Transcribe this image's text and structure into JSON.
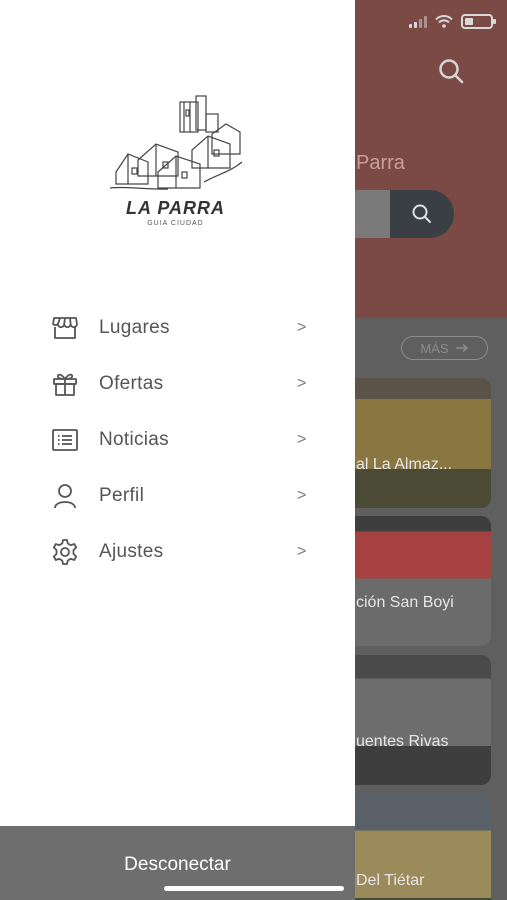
{
  "background": {
    "hero_title": "Parra",
    "more_label": "MÁS",
    "cards": [
      {
        "label": "al La Almaz..."
      },
      {
        "label": "ción San Boyi"
      },
      {
        "label": "uentes Rivas"
      },
      {
        "label": "Del Tiétar"
      }
    ]
  },
  "drawer": {
    "logo": {
      "title": "LA PARRA",
      "subtitle": "GUIA CIUDAD"
    },
    "menu": [
      {
        "label": "Lugares",
        "icon": "store-icon"
      },
      {
        "label": "Ofertas",
        "icon": "gift-icon"
      },
      {
        "label": "Noticias",
        "icon": "news-icon"
      },
      {
        "label": "Perfil",
        "icon": "user-icon"
      },
      {
        "label": "Ajustes",
        "icon": "gear-icon"
      }
    ],
    "chevron": ">",
    "footer_label": "Desconectar"
  },
  "colors": {
    "drawer_bg": "#ffffff",
    "footer_bg": "#6e6e6e",
    "hero_bg": "#7b4a45",
    "text": "#555555"
  }
}
